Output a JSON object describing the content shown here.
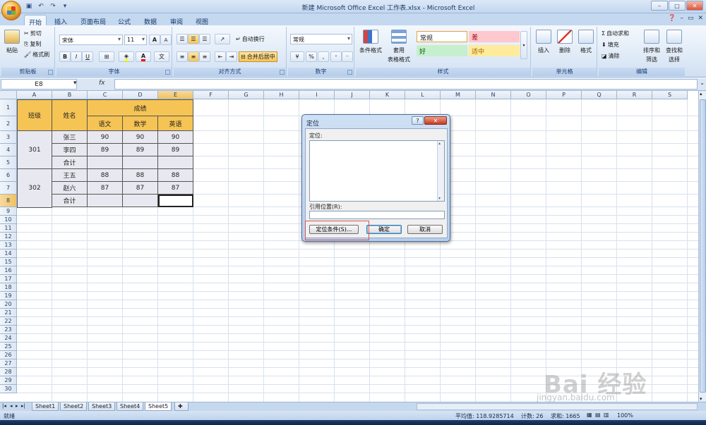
{
  "window": {
    "title": "新建 Microsoft Office Excel 工作表.xlsx - Microsoft Excel",
    "controls": [
      "–",
      "□",
      "✕"
    ]
  },
  "ribbon_tabs": [
    "开始",
    "插入",
    "页面布局",
    "公式",
    "数据",
    "审阅",
    "视图"
  ],
  "active_tab": "开始",
  "clipboard": {
    "group": "剪贴板",
    "paste": "粘贴",
    "cut": "剪切",
    "copy": "复制",
    "format_painter": "格式刷"
  },
  "font": {
    "group": "字体",
    "name": "宋体",
    "size": "11",
    "bold": "B",
    "italic": "I",
    "underline": "U",
    "grow": "A",
    "shrink": "A",
    "fill_color": "#ffff00",
    "text_color": "#ff0000"
  },
  "alignment": {
    "group": "对齐方式",
    "wrap": "自动换行",
    "merge": "合并后居中"
  },
  "number": {
    "group": "数字",
    "format": "常规",
    "percent": "%",
    "comma": ","
  },
  "styles": {
    "group": "样式",
    "conditional": "条件格式",
    "table_format_1": "套用",
    "table_format_2": "表格格式",
    "normal": "常规",
    "bad": "差",
    "good": "好",
    "neutral": "适中"
  },
  "cells_group": {
    "group": "单元格",
    "insert": "插入",
    "delete": "删除",
    "format": "格式"
  },
  "editing": {
    "group": "编辑",
    "autosum": "自动求和",
    "fill": "填充",
    "clear": "清除",
    "sort_1": "排序和",
    "sort_2": "筛选",
    "find_1": "查找和",
    "find_2": "选择"
  },
  "formula_bar": {
    "name_box": "E8",
    "fx": "fx",
    "value": ""
  },
  "grid": {
    "columns": [
      "A",
      "B",
      "C",
      "D",
      "E",
      "F",
      "G",
      "H",
      "I",
      "J",
      "K",
      "L",
      "M",
      "N",
      "O",
      "P",
      "Q",
      "R",
      "S"
    ],
    "rows": [
      "1",
      "2",
      "3",
      "4",
      "5",
      "6",
      "7",
      "8",
      "9",
      "10",
      "11",
      "12",
      "13",
      "14",
      "15",
      "16",
      "17",
      "18",
      "19",
      "20",
      "21",
      "22",
      "23",
      "24",
      "25",
      "26",
      "27",
      "28",
      "29",
      "30"
    ],
    "selected_column": "E",
    "selected_row": "8"
  },
  "table": {
    "class_header": "班级",
    "name_header": "姓名",
    "score_header": "成绩",
    "subjects": [
      "语文",
      "数学",
      "英语"
    ],
    "class_301": "301",
    "class_302": "302",
    "rows": [
      {
        "name": "张三",
        "chinese": "90",
        "math": "90",
        "english": "90"
      },
      {
        "name": "李四",
        "chinese": "89",
        "math": "89",
        "english": "89"
      },
      {
        "name": "合计",
        "chinese": "",
        "math": "",
        "english": ""
      },
      {
        "name": "王五",
        "chinese": "88",
        "math": "88",
        "english": "88"
      },
      {
        "name": "赵六",
        "chinese": "87",
        "math": "87",
        "english": "87"
      },
      {
        "name": "合计",
        "chinese": "",
        "math": "",
        "english": ""
      }
    ]
  },
  "sheets": [
    "Sheet1",
    "Sheet2",
    "Sheet3",
    "Sheet4",
    "Sheet5"
  ],
  "active_sheet": "Sheet5",
  "status": {
    "ready": "就绪",
    "average": "平均值: 118.9285714",
    "count": "计数: 26",
    "sum": "求和: 1665",
    "zoom": "100%"
  },
  "dialog": {
    "title": "定位",
    "help": "?",
    "close": "✕",
    "goto_label": "定位:",
    "reference_label": "引用位置(R):",
    "reference_value": "",
    "special_button": "定位条件(S)...",
    "ok_button": "确定",
    "cancel_button": "取消"
  },
  "watermark": {
    "text": "Bai 经验",
    "url": "jingyan.baidu.com"
  }
}
